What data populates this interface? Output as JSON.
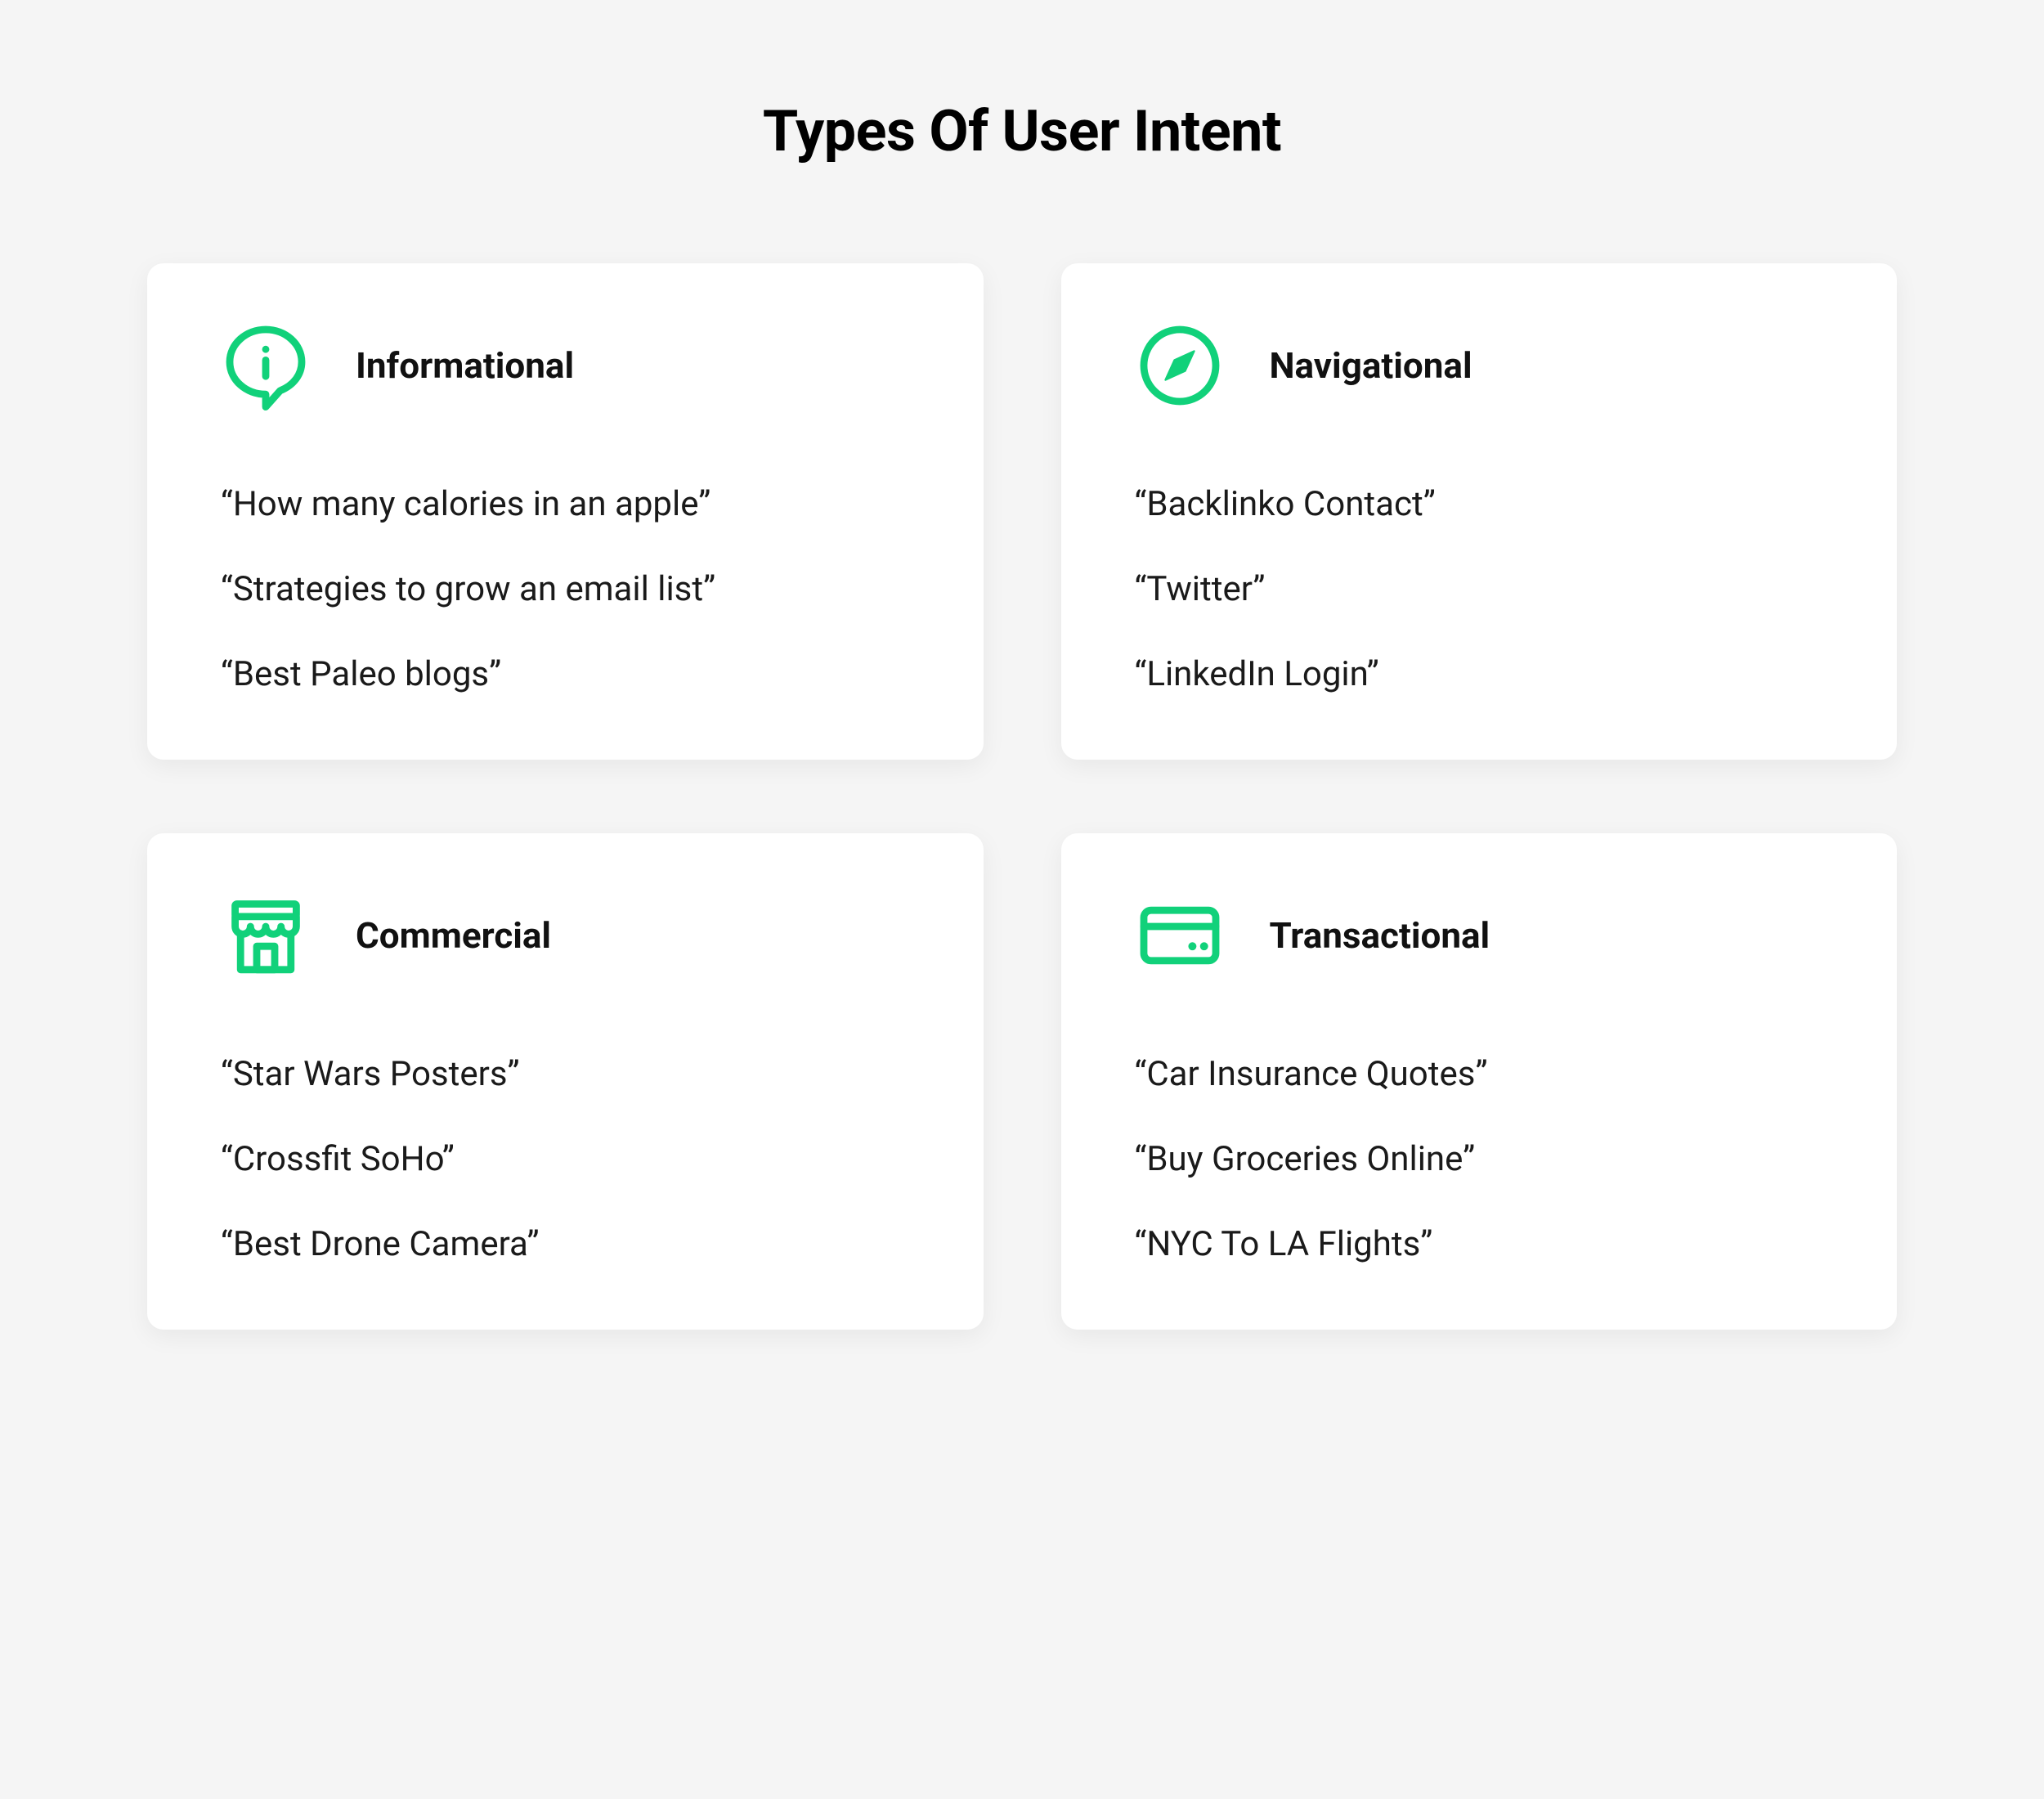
{
  "title": "Types Of User Intent",
  "accent": "#11d17a",
  "cards": [
    {
      "icon": "info-bubble-icon",
      "heading": "Informational",
      "examples": [
        "“How many calories in an apple”",
        "“Strategies to grow an email list”",
        "“Best Paleo blogs”"
      ]
    },
    {
      "icon": "compass-icon",
      "heading": "Navigational",
      "examples": [
        "“Backlinko Contact”",
        "“Twitter”",
        "“LinkedIn Login”"
      ]
    },
    {
      "icon": "storefront-icon",
      "heading": "Commercial",
      "examples": [
        "“Star Wars Posters”",
        "“Crossfit SoHo”",
        "“Best Drone Camera”"
      ]
    },
    {
      "icon": "credit-card-icon",
      "heading": "Transactional",
      "examples": [
        "“Car Insurance Quotes”",
        "“Buy Groceries Online”",
        "“NYC To LA Flights”"
      ]
    }
  ]
}
